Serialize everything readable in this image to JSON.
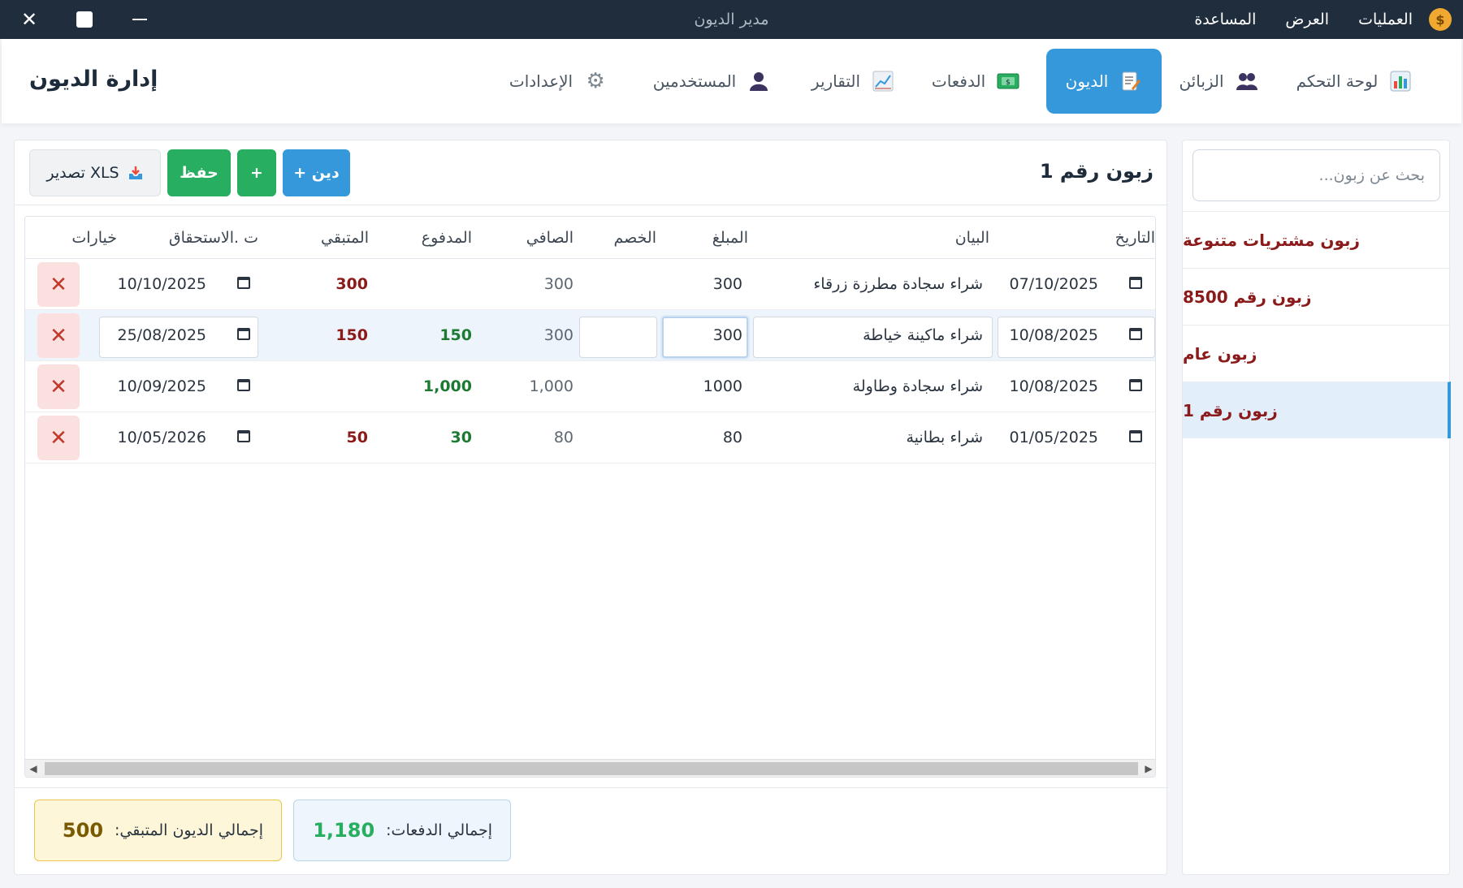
{
  "window": {
    "title": "مدير الديون",
    "menus": [
      "العمليات",
      "العرض",
      "المساعدة"
    ]
  },
  "app": {
    "brand": "إدارة الديون",
    "nav": [
      {
        "label": "لوحة التحكم",
        "icon": "bar-chart-icon"
      },
      {
        "label": "الزبائن",
        "icon": "users-icon"
      },
      {
        "label": "الديون",
        "icon": "memo-icon"
      },
      {
        "label": "الدفعات",
        "icon": "money-icon"
      },
      {
        "label": "التقارير",
        "icon": "line-chart-icon"
      },
      {
        "label": "المستخدمين",
        "icon": "user-icon"
      },
      {
        "label": "الإعدادات",
        "icon": "gear-icon"
      }
    ],
    "active_nav": "الديون"
  },
  "sidebar": {
    "search_placeholder": "بحث عن زبون...",
    "customers": [
      "زبون مشتريات متنوعة",
      "زبون رقم 8500",
      "زبون عام",
      "زبون رقم 1"
    ],
    "active_customer": "زبون رقم 1"
  },
  "main": {
    "customer_title": "زبون رقم 1",
    "buttons": {
      "add_debt": "+ دين",
      "add": "+",
      "save": "حفظ",
      "export": "تصدير XLS"
    },
    "columns": {
      "date": "التاريخ",
      "description": "البيان",
      "amount": "المبلغ",
      "discount": "الخصم",
      "net": "الصافي",
      "paid": "المدفوع",
      "remaining": "المتبقي",
      "due": "ت .الاستحقاق",
      "options": "خيارات"
    },
    "rows": [
      {
        "date": "07/10/2025",
        "description": "شراء سجادة مطرزة  زرقاء",
        "amount": "300",
        "discount": "",
        "net": "300",
        "paid": "",
        "remaining": "300",
        "due": "10/10/2025"
      },
      {
        "date": "10/08/2025",
        "description": "شراء ماكينة  خياطة",
        "amount": "300",
        "discount": "",
        "net": "300",
        "paid": "150",
        "remaining": "150",
        "due": "25/08/2025"
      },
      {
        "date": "10/08/2025",
        "description": "شراء سجادة وطاولة",
        "amount": "1000",
        "discount": "",
        "net": "1,000",
        "paid": "1,000",
        "remaining": "",
        "due": "10/09/2025"
      },
      {
        "date": "01/05/2025",
        "description": "شراء بطانية",
        "amount": "80",
        "discount": "",
        "net": "80",
        "paid": "30",
        "remaining": "50",
        "due": "10/05/2026"
      }
    ],
    "editing_row": 1,
    "totals": {
      "payments_label": "إجمالي الدفعات:",
      "payments_value": "1,180",
      "remaining_label": "إجمالي الديون المتبقي:",
      "remaining_value": "500"
    }
  },
  "colors": {
    "titlebar": "#1f2d3d",
    "accent": "#3498db",
    "success": "#27ae60",
    "danger_text": "#8b1a1a"
  }
}
